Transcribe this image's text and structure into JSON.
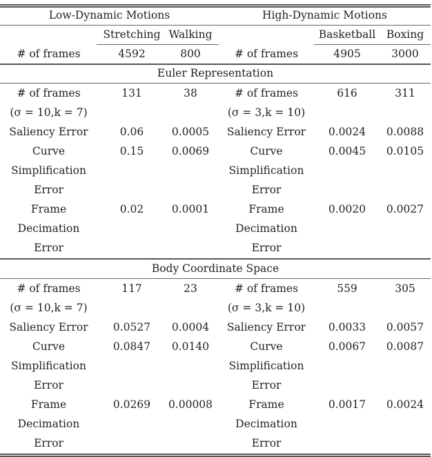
{
  "header": {
    "group_left": "Low-Dynamic Motions",
    "group_right": "High-Dynamic Motions",
    "columns": [
      "Stretching",
      "Walking",
      "Basketball",
      "Boxing"
    ],
    "frames_label": "# of frames",
    "frames_values": [
      "4592",
      "800",
      "4905",
      "3000"
    ]
  },
  "sections": [
    {
      "title": "Euler Representation",
      "left_params": "(σ = 10,k = 7)",
      "right_params": "(σ = 3,k = 10)",
      "frames_label": "# of frames",
      "frames": [
        "131",
        "38",
        "616",
        "311"
      ],
      "saliency_label": "Saliency Error",
      "saliency": [
        "0.06",
        "0.0005",
        "0.0024",
        "0.0088"
      ],
      "curve_label": [
        "Curve",
        "Simplification",
        "Error"
      ],
      "curve": [
        "0.15",
        "0.0069",
        "0.0045",
        "0.0105"
      ],
      "decimation_label": [
        "Frame",
        "Decimation",
        "Error"
      ],
      "decimation": [
        "0.02",
        "0.0001",
        "0.0020",
        "0.0027"
      ]
    },
    {
      "title": "Body Coordinate Space",
      "left_params": "(σ = 10,k = 7)",
      "right_params": "(σ = 3,k = 10)",
      "frames_label": "# of frames",
      "frames": [
        "117",
        "23",
        "559",
        "305"
      ],
      "saliency_label": "Saliency Error",
      "saliency": [
        "0.0527",
        "0.0004",
        "0.0033",
        "0.0057"
      ],
      "curve_label": [
        "Curve",
        "Simplification",
        "Error"
      ],
      "curve": [
        "0.0847",
        "0.0140",
        "0.0067",
        "0.0087"
      ],
      "decimation_label": [
        "Frame",
        "Decimation",
        "Error"
      ],
      "decimation": [
        "0.0269",
        "0.00008",
        "0.0017",
        "0.0024"
      ]
    }
  ]
}
